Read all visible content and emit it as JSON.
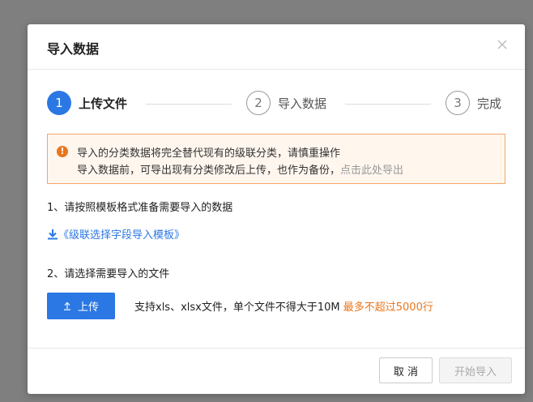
{
  "dialog": {
    "title": "导入数据"
  },
  "steps": [
    {
      "number": "1",
      "label": "上传文件",
      "state": "active"
    },
    {
      "number": "2",
      "label": "导入数据",
      "state": "pending"
    },
    {
      "number": "3",
      "label": "完成",
      "state": "pending"
    }
  ],
  "warning": {
    "icon": "exclamation-circle-icon",
    "line1": "导入的分类数据将完全替代现有的级联分类，请慎重操作",
    "line2": "导入数据前，可导出现有分类修改后上传，也作为备份，",
    "link": "点击此处导出"
  },
  "section1": {
    "title": "1、请按照模板格式准备需要导入的数据",
    "template_link": "《级联选择字段导入模板》",
    "icon": "download-icon"
  },
  "section2": {
    "title": "2、请选择需要导入的文件",
    "upload_label": "上传",
    "upload_icon": "upload-icon",
    "hint": "支持xls、xlsx文件，单个文件不得大于10M ",
    "limit": "最多不超过5000行"
  },
  "footer": {
    "cancel_label": "取 消",
    "start_label": "开始导入"
  },
  "colors": {
    "primary": "#2b78e4",
    "warning": "#e8761c",
    "overlay": "#7f7f7f"
  }
}
